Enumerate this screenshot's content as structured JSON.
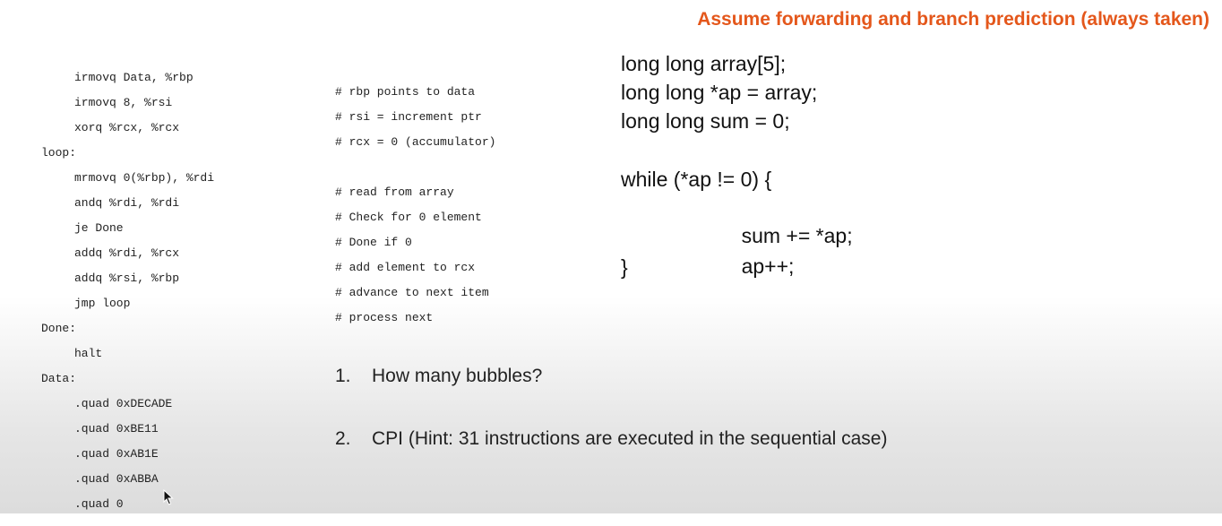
{
  "header": {
    "note": "Assume forwarding and branch prediction (always taken)"
  },
  "assembly": {
    "lines": [
      {
        "instr": "irmovq Data, %rbp",
        "comment": "# rbp points to data"
      },
      {
        "instr": "irmovq 8, %rsi",
        "comment": "# rsi = increment ptr"
      },
      {
        "instr": "xorq %rcx, %rcx",
        "comment": "# rcx = 0 (accumulator)"
      },
      {
        "label": "loop:"
      },
      {
        "instr": "mrmovq 0(%rbp), %rdi",
        "comment": "# read from array"
      },
      {
        "instr": "andq %rdi, %rdi",
        "comment": "# Check for 0 element"
      },
      {
        "instr": "je Done",
        "comment": "# Done if 0"
      },
      {
        "instr": "addq %rdi, %rcx",
        "comment": "# add element to rcx"
      },
      {
        "instr": "addq %rsi, %rbp",
        "comment": "# advance to next item"
      },
      {
        "instr": "jmp loop",
        "comment": "# process next"
      },
      {
        "label": "Done:"
      },
      {
        "instr": "halt"
      },
      {
        "label": "Data:"
      },
      {
        "instr": ".quad 0xDECADE"
      },
      {
        "instr": ".quad 0xBE11"
      },
      {
        "instr": ".quad 0xAB1E"
      },
      {
        "instr": ".quad 0xABBA"
      },
      {
        "instr": ".quad 0"
      }
    ]
  },
  "c_code": {
    "lines": [
      "long long array[5];",
      "long long *ap = array;",
      "long long sum = 0;",
      "",
      "while (*ap != 0) {",
      "        sum += *ap;",
      "        ap++;",
      "}"
    ]
  },
  "questions": [
    {
      "number": "1.",
      "text": "How many bubbles?"
    },
    {
      "number": "2.",
      "text": "CPI (Hint: 31 instructions are executed in the sequential case)"
    }
  ],
  "colors": {
    "accent": "#e4571b"
  },
  "icons": {
    "cursor": "mouse-pointer-icon"
  }
}
